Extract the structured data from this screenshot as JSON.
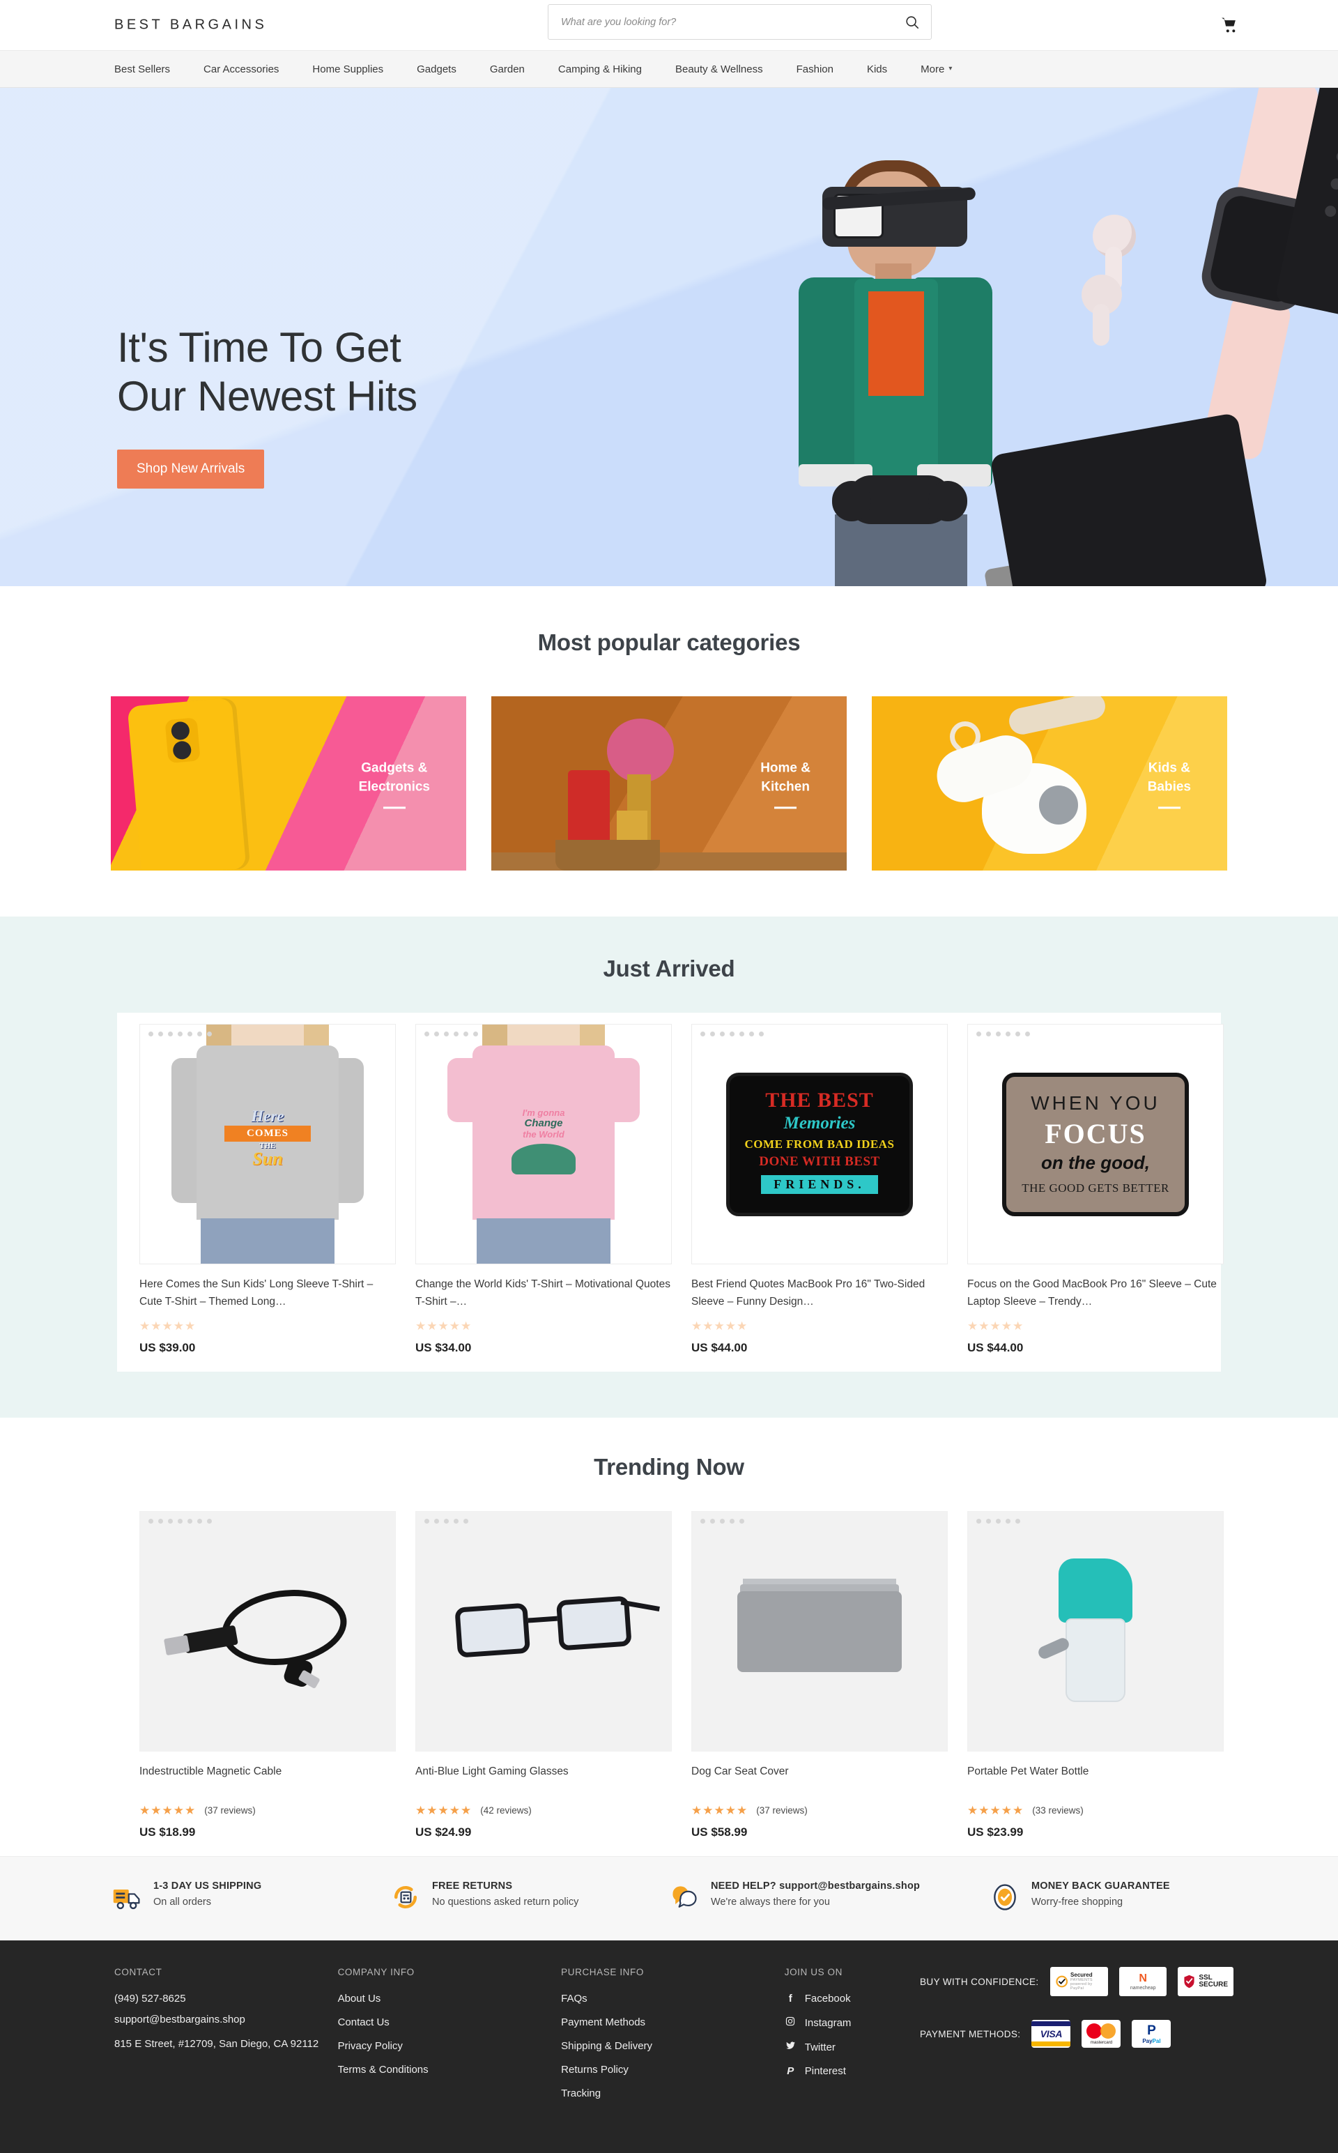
{
  "header": {
    "logo": "BEST BARGAINS",
    "search_placeholder": "What are you looking for?",
    "search_value": "",
    "search_icon": "search-icon",
    "cart_icon": "shopping-cart-icon"
  },
  "nav": {
    "items": [
      {
        "label": "Best Sellers"
      },
      {
        "label": "Car Accessories"
      },
      {
        "label": "Home Supplies"
      },
      {
        "label": "Gadgets"
      },
      {
        "label": "Garden"
      },
      {
        "label": "Camping & Hiking"
      },
      {
        "label": "Beauty & Wellness"
      },
      {
        "label": "Fashion"
      },
      {
        "label": "Kids"
      },
      {
        "label": "More"
      }
    ],
    "more_chevron": "▾"
  },
  "hero": {
    "title": "It's Time To Get\nOur Newest Hits",
    "cta_label": "Shop New Arrivals",
    "cta_color": "#ee7c55",
    "bg_color": "#d7e6fc"
  },
  "categories": {
    "title": "Most popular categories",
    "items": [
      {
        "label": "Gadgets &\nElectronics"
      },
      {
        "label": "Home &\nKitchen"
      },
      {
        "label": "Kids &\nBabies"
      }
    ]
  },
  "just_arrived": {
    "title": "Just Arrived",
    "bg_color": "#eaf4f3",
    "products": [
      {
        "title": "Here Comes the Sun Kids' Long Sleeve T-Shirt – Cute T-Shirt – Themed Long…",
        "price": "US $39.00",
        "stars": "★★★★★",
        "star_color": "#fbd6b5",
        "art": {
          "l1": "Here",
          "l2": "COMES",
          "l3": "THE",
          "l4": "Sun"
        }
      },
      {
        "title": "Change the World Kids' T-Shirt – Motivational Quotes T-Shirt –…",
        "price": "US $34.00",
        "stars": "★★★★★",
        "star_color": "#fbd6b5",
        "art": {
          "l1": "I'm gonna",
          "l2": "Change",
          "l3": "the World"
        }
      },
      {
        "title": "Best Friend Quotes MacBook Pro 16\" Two-Sided Sleeve – Funny Design…",
        "price": "US $44.00",
        "stars": "★★★★★",
        "star_color": "#fbd6b5",
        "art": {
          "l1": "THE BEST",
          "l2": "Memories",
          "l3": "COME FROM BAD IDEAS",
          "l4": "DONE WITH BEST",
          "l5": "FRIENDS."
        }
      },
      {
        "title": "Focus on the Good MacBook Pro 16\" Sleeve – Cute Laptop Sleeve – Trendy…",
        "price": "US $44.00",
        "stars": "★★★★★",
        "star_color": "#fbd6b5",
        "art": {
          "l1": "WHEN YOU",
          "l2": "FOCUS",
          "l3": "on the good,",
          "l4": "THE GOOD GETS BETTER"
        }
      }
    ]
  },
  "trending": {
    "title": "Trending Now",
    "products": [
      {
        "title": "Indestructible Magnetic Cable",
        "price": "US $18.99",
        "stars": "★★★★★",
        "reviews": "(37 reviews)"
      },
      {
        "title": "Anti-Blue Light Gaming Glasses",
        "price": "US $24.99",
        "stars": "★★★★★",
        "reviews": "(42 reviews)"
      },
      {
        "title": "Dog Car Seat Cover",
        "price": "US $58.99",
        "stars": "★★★★★",
        "reviews": "(37 reviews)"
      },
      {
        "title": "Portable Pet Water Bottle",
        "price": "US $23.99",
        "stars": "★★★★★",
        "reviews": "(33 reviews)"
      }
    ]
  },
  "benefits": [
    {
      "icon": "truck-icon",
      "title": "1-3 DAY US SHIPPING",
      "sub": "On all orders"
    },
    {
      "icon": "returns-icon",
      "title": "FREE RETURNS",
      "sub": "No questions asked return policy"
    },
    {
      "icon": "chat-icon",
      "title": "NEED HELP? support@bestbargains.shop",
      "sub": "We're always there for you"
    },
    {
      "icon": "guarantee-icon",
      "title": "MONEY BACK GUARANTEE",
      "sub": "Worry-free shopping"
    }
  ],
  "footer": {
    "contact": {
      "heading": "CONTACT",
      "phone": "(949) 527-8625",
      "email": "support@bestbargains.shop",
      "address": "815 E Street, #12709, San Diego, CA 92112"
    },
    "company": {
      "heading": "COMPANY INFO",
      "links": [
        "About Us",
        "Contact Us",
        "Privacy Policy",
        "Terms & Conditions"
      ]
    },
    "purchase": {
      "heading": "PURCHASE INFO",
      "links": [
        "FAQs",
        "Payment Methods",
        "Shipping & Delivery",
        "Returns Policy",
        "Tracking"
      ]
    },
    "social": {
      "heading": "JOIN US ON",
      "links": [
        {
          "label": "Facebook",
          "icon": "facebook-icon",
          "glyph": "f"
        },
        {
          "label": "Instagram",
          "icon": "instagram-icon",
          "glyph": "⊡"
        },
        {
          "label": "Twitter",
          "icon": "twitter-icon",
          "glyph": "🐦"
        },
        {
          "label": "Pinterest",
          "icon": "pinterest-icon",
          "glyph": "P"
        }
      ]
    },
    "trust": {
      "confidence_label": "BUY WITH CONFIDENCE:",
      "badges": [
        {
          "name": "paypal-secured-badge",
          "line1": "Secured",
          "line2": "PAYMENTS",
          "line3": "powered by PayPal"
        },
        {
          "name": "namecheap-badge",
          "line1": "namecheap"
        },
        {
          "name": "ssl-secure-badge",
          "line1": "SSL",
          "line2": "SECURE"
        }
      ],
      "payment_label": "PAYMENT METHODS:",
      "payments": [
        {
          "name": "visa-logo",
          "label": "VISA"
        },
        {
          "name": "mastercard-logo",
          "label": "mastercard"
        },
        {
          "name": "paypal-logo",
          "label": "PayPal"
        }
      ]
    }
  }
}
